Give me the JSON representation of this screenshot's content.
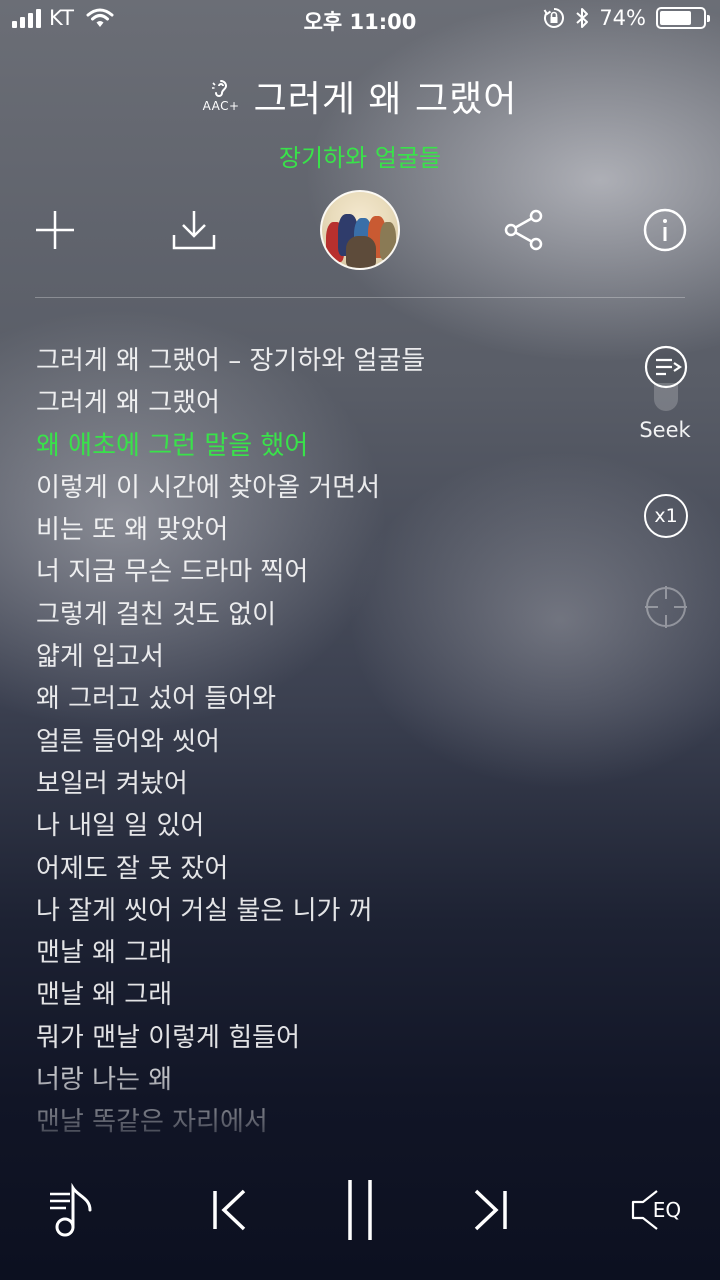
{
  "status_bar": {
    "carrier": "KT",
    "time": "오후 11:00",
    "battery": "74%"
  },
  "header": {
    "codec": "AAC+",
    "title": "그러게 왜 그랬어",
    "artist": "장기하와 얼굴들"
  },
  "lyrics": [
    "그러게 왜 그랬어 – 장기하와 얼굴들",
    "그러게 왜 그랬어",
    "왜 애초에 그런 말을 했어",
    "이렇게 이 시간에 찾아올 거면서",
    "비는 또 왜 맞았어",
    "너 지금 무슨 드라마 찍어",
    "그렇게 걸친 것도 없이",
    "얇게 입고서",
    "왜 그러고 섰어 들어와",
    "얼른 들어와 씻어",
    "보일러 켜놨어",
    "나 내일 일 있어",
    "어제도 잘 못 잤어",
    "나 잘게 씻어 거실 불은 니가 꺼",
    "맨날 왜 그래",
    "맨날 왜 그래",
    "뭐가 맨날 이렇게 힘들어",
    "너랑 나는 왜",
    "맨날 똑같은 자리에서"
  ],
  "active_lyric_index": 2,
  "side_controls": {
    "seek_label": "Seek",
    "speed_label": "x1"
  },
  "bottom_controls": {
    "eq_label": "EQ"
  },
  "colors": {
    "accent": "#39e24a"
  }
}
